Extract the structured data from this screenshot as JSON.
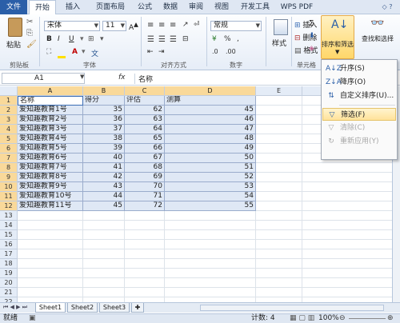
{
  "tabs": [
    "文件",
    "开始",
    "插入",
    "页面布局",
    "公式",
    "数据",
    "审阅",
    "视图",
    "开发工具",
    "WPS PDF"
  ],
  "ribbon": {
    "paste": "粘贴",
    "clipboard": "剪贴板",
    "font_name": "宋体",
    "font_size": "11",
    "font_group": "字体",
    "align_group": "对齐方式",
    "number_format": "常规",
    "number_group": "数字",
    "styles": "样式",
    "insert": "插入",
    "delete": "删除",
    "format": "格式",
    "cells_group": "单元格",
    "sort_filter": "排序和筛选",
    "find_select": "查找和选择"
  },
  "formula_bar": {
    "cell_ref": "A1",
    "fx": "fx",
    "content": "名称"
  },
  "columns": [
    "A",
    "B",
    "C",
    "D",
    "E"
  ],
  "rows": [
    "1",
    "2",
    "3",
    "4",
    "5",
    "6",
    "7",
    "8",
    "9",
    "10",
    "11",
    "12",
    "13",
    "14",
    "15",
    "16",
    "17",
    "18",
    "19",
    "20",
    "21",
    "22"
  ],
  "table": {
    "headers": [
      "名称",
      "得分",
      "评估",
      "测算"
    ],
    "data": [
      [
        "爱知趣教育1号",
        "35",
        "62",
        "45"
      ],
      [
        "爱知趣教育2号",
        "36",
        "63",
        "46"
      ],
      [
        "爱知趣教育3号",
        "37",
        "64",
        "47"
      ],
      [
        "爱知趣教育4号",
        "38",
        "65",
        "48"
      ],
      [
        "爱知趣教育5号",
        "39",
        "66",
        "49"
      ],
      [
        "爱知趣教育6号",
        "40",
        "67",
        "50"
      ],
      [
        "爱知趣教育7号",
        "41",
        "68",
        "51"
      ],
      [
        "爱知趣教育8号",
        "42",
        "69",
        "52"
      ],
      [
        "爱知趣教育9号",
        "43",
        "70",
        "53"
      ],
      [
        "爱知趣教育10号",
        "44",
        "71",
        "54"
      ],
      [
        "爱知趣教育11号",
        "45",
        "72",
        "55"
      ]
    ]
  },
  "sort_menu": {
    "items": [
      {
        "label": "升序(S)",
        "icon": "A↓Z"
      },
      {
        "label": "降序(O)",
        "icon": "Z↓A"
      },
      {
        "label": "自定义排序(U)...",
        "icon": "⇅"
      },
      {
        "label": "筛选(F)",
        "icon": "▽"
      },
      {
        "label": "清除(C)",
        "icon": "▽"
      },
      {
        "label": "重新应用(Y)",
        "icon": "↻"
      }
    ]
  },
  "sheets": [
    "Sheet1",
    "Sheet2",
    "Sheet3"
  ],
  "status": {
    "ready": "就绪",
    "count": "计数: 4",
    "zoom": "100%"
  }
}
